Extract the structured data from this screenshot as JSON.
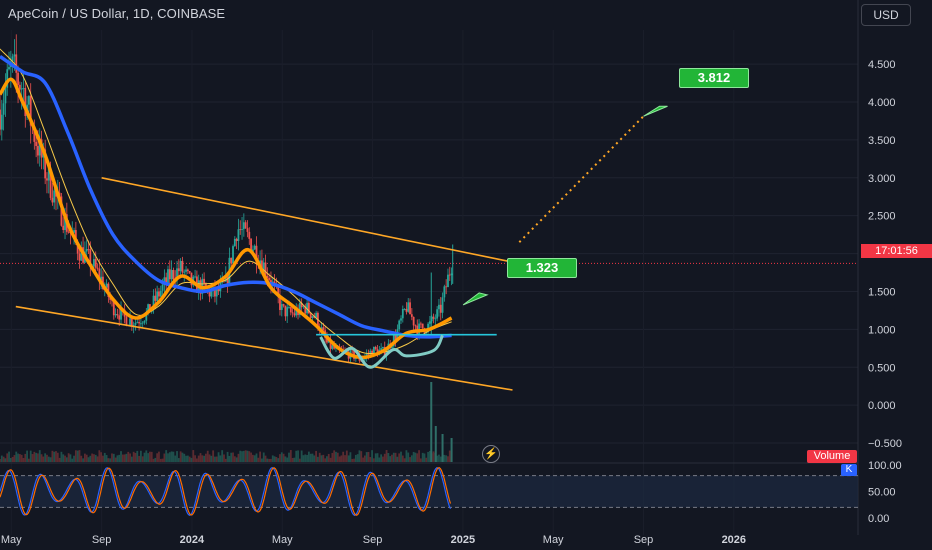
{
  "header": {
    "title": "ApeCoin / US Dollar, 1D, COINBASE",
    "currency": "USD"
  },
  "last_price_timer": "17:01:56",
  "volume_label": "Volume",
  "stoch_badge": "K",
  "icons": {
    "lightning": "lightning-icon"
  },
  "colors": {
    "background": "#131722",
    "candle_up": "#26a69a",
    "candle_down": "#ef5350",
    "ma_fast": "#ff9800",
    "ma_slow": "#2962ff",
    "ma_thin": "#f7c948",
    "channel": "#ffa726",
    "pattern": "#80cbc4",
    "target": "#22b537",
    "stoch_k": "#2962ff",
    "stoch_d": "#ff6d00",
    "price_line": "#f23645"
  },
  "chart_data": {
    "type": "line",
    "symbol": "ApeCoin / US Dollar",
    "interval": "1D",
    "exchange": "COINBASE",
    "x_tick_labels": [
      "May",
      "Sep",
      "2024",
      "May",
      "Sep",
      "2025",
      "May",
      "Sep",
      "2026"
    ],
    "y_tick_labels": [
      "4.500",
      "4.000",
      "3.500",
      "3.000",
      "2.500",
      "2.000",
      "1.500",
      "1.000",
      "0.500",
      "0.000",
      "−0.500"
    ],
    "y_ticks": [
      4.5,
      4.0,
      3.5,
      3.0,
      2.5,
      2.0,
      1.5,
      1.0,
      0.5,
      0.0,
      -0.5
    ],
    "ylim": [
      -0.75,
      4.95
    ],
    "x_range_months": [
      0,
      38
    ],
    "last_price": 1.87,
    "price_path": [
      [
        0,
        3.9
      ],
      [
        0.5,
        4.45
      ],
      [
        1,
        4.2
      ],
      [
        1.5,
        3.6
      ],
      [
        2,
        3.1
      ],
      [
        2.5,
        2.7
      ],
      [
        3,
        2.35
      ],
      [
        3.5,
        2.05
      ],
      [
        4,
        1.9
      ],
      [
        4.5,
        1.65
      ],
      [
        5,
        1.3
      ],
      [
        5.5,
        1.15
      ],
      [
        6,
        1.1
      ],
      [
        6.5,
        1.2
      ],
      [
        7,
        1.45
      ],
      [
        7.5,
        1.7
      ],
      [
        8,
        1.8
      ],
      [
        8.5,
        1.6
      ],
      [
        9,
        1.55
      ],
      [
        9.5,
        1.45
      ],
      [
        10,
        1.6
      ],
      [
        10.5,
        2.35
      ],
      [
        11,
        2.2
      ],
      [
        11.5,
        1.95
      ],
      [
        12,
        1.65
      ],
      [
        12.5,
        1.25
      ],
      [
        13,
        1.2
      ],
      [
        13.5,
        1.3
      ],
      [
        14,
        1.15
      ],
      [
        14.5,
        0.8
      ],
      [
        15,
        0.7
      ],
      [
        15.5,
        0.68
      ],
      [
        16,
        0.6
      ],
      [
        16.5,
        0.72
      ],
      [
        17,
        0.7
      ],
      [
        17.5,
        0.9
      ],
      [
        18,
        1.3
      ],
      [
        18.5,
        1.0
      ],
      [
        19,
        1.05
      ],
      [
        19.5,
        1.25
      ],
      [
        20,
        1.87
      ]
    ],
    "series": [
      {
        "values": [
          [
            0,
            4.1
          ],
          [
            0.5,
            4.3
          ],
          [
            1,
            4.0
          ],
          [
            2,
            3.3
          ],
          [
            3,
            2.4
          ],
          [
            4,
            1.85
          ],
          [
            5,
            1.4
          ],
          [
            6,
            1.15
          ],
          [
            7,
            1.35
          ],
          [
            8,
            1.7
          ],
          [
            9,
            1.55
          ],
          [
            10,
            1.7
          ],
          [
            11,
            2.05
          ],
          [
            12,
            1.55
          ],
          [
            13,
            1.3
          ],
          [
            14,
            1.05
          ],
          [
            15,
            0.75
          ],
          [
            16,
            0.63
          ],
          [
            17,
            0.72
          ],
          [
            18,
            0.95
          ],
          [
            19,
            1.0
          ],
          [
            20,
            1.15
          ]
        ]
      },
      {
        "values": [
          [
            0,
            4.6
          ],
          [
            1,
            4.4
          ],
          [
            2,
            4.25
          ],
          [
            3,
            3.6
          ],
          [
            4,
            2.85
          ],
          [
            5,
            2.25
          ],
          [
            6,
            1.9
          ],
          [
            7,
            1.65
          ],
          [
            8,
            1.55
          ],
          [
            9,
            1.5
          ],
          [
            10,
            1.58
          ],
          [
            11,
            1.62
          ],
          [
            12,
            1.6
          ],
          [
            13,
            1.5
          ],
          [
            14,
            1.35
          ],
          [
            15,
            1.2
          ],
          [
            16,
            1.05
          ],
          [
            17,
            0.98
          ],
          [
            18,
            0.92
          ],
          [
            19,
            0.9
          ],
          [
            20,
            0.92
          ]
        ]
      },
      {
        "values": [
          [
            0,
            4.7
          ],
          [
            1,
            4.35
          ],
          [
            2,
            3.6
          ],
          [
            3,
            2.8
          ],
          [
            4,
            2.1
          ],
          [
            5,
            1.6
          ],
          [
            6,
            1.2
          ],
          [
            7,
            1.3
          ],
          [
            8,
            1.6
          ],
          [
            9,
            1.6
          ],
          [
            10,
            1.65
          ],
          [
            11,
            1.9
          ],
          [
            12,
            1.7
          ],
          [
            13,
            1.45
          ],
          [
            14,
            1.15
          ],
          [
            15,
            0.9
          ],
          [
            16,
            0.7
          ],
          [
            17,
            0.7
          ],
          [
            18,
            0.8
          ],
          [
            19,
            0.98
          ],
          [
            20,
            1.1
          ]
        ]
      }
    ],
    "channel_upper": [
      [
        4.5,
        3.0
      ],
      [
        22.5,
        1.9
      ]
    ],
    "channel_lower": [
      [
        0.7,
        1.3
      ],
      [
        22.7,
        0.2
      ]
    ],
    "neckline": [
      [
        14.0,
        0.93
      ],
      [
        22.0,
        0.93
      ]
    ],
    "pattern_curve": [
      [
        14.2,
        0.9
      ],
      [
        14.8,
        0.62
      ],
      [
        15.6,
        0.75
      ],
      [
        16.4,
        0.5
      ],
      [
        17.4,
        0.73
      ],
      [
        18.0,
        0.65
      ],
      [
        19.2,
        0.72
      ],
      [
        19.6,
        0.92
      ]
    ],
    "projection": [
      [
        23.0,
        2.15
      ],
      [
        28.5,
        3.812
      ]
    ],
    "annotations": [
      {
        "label": "3.812",
        "x": 28.5,
        "y": 3.812
      },
      {
        "label": "1.323",
        "x": 20.6,
        "y": 1.323
      }
    ],
    "volume": {
      "label": "Volume",
      "spikes": [
        [
          19.1,
          1.0
        ],
        [
          19.3,
          0.45
        ],
        [
          19.6,
          0.35
        ],
        [
          20.0,
          0.3
        ]
      ]
    },
    "stochastic": {
      "badge": "K",
      "y_tick_labels": [
        "100.00",
        "50.00",
        "0.00"
      ],
      "y_ticks": [
        100,
        50,
        0
      ],
      "levels": [
        80,
        20
      ]
    }
  }
}
